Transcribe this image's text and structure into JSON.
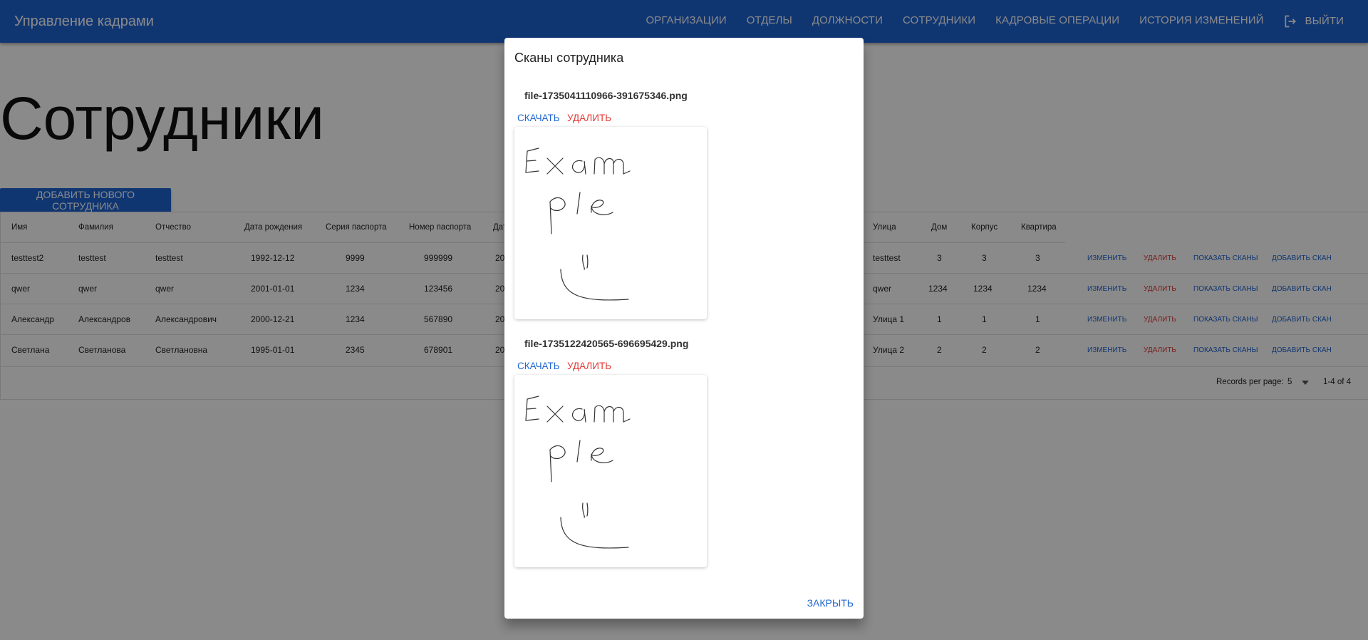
{
  "app": {
    "title": "Управление кадрами"
  },
  "nav": {
    "items": [
      "Организации",
      "Отделы",
      "Должности",
      "Сотрудники",
      "Кадровые операции",
      "История изменений"
    ],
    "logout": "Выйти",
    "active_index": 0
  },
  "page": {
    "title": "Сотрудники",
    "add_button": "Добавить нового сотрудника"
  },
  "table": {
    "headers_left": [
      "Имя",
      "Фамилия",
      "Отчество",
      "Дата рождения",
      "Серия паспорта",
      "Номер паспорта",
      "Дат"
    ],
    "headers_right": [
      "Улица",
      "Дом",
      "Корпус",
      "Квартира"
    ],
    "rows": [
      {
        "left": [
          "testtest2",
          "testtest",
          "testtest",
          "1992-12-12",
          "9999",
          "999999",
          "20"
        ],
        "right": [
          "testtest",
          "3",
          "3",
          "3"
        ]
      },
      {
        "left": [
          "qwer",
          "qwer",
          "qwer",
          "2001-01-01",
          "1234",
          "123456",
          "20"
        ],
        "right": [
          "qwer",
          "1234",
          "1234",
          "1234"
        ]
      },
      {
        "left": [
          "Александр",
          "Александров",
          "Александрович",
          "2000-12-21",
          "1234",
          "567890",
          "20"
        ],
        "right": [
          "Улица 1",
          "1",
          "1",
          "1"
        ]
      },
      {
        "left": [
          "Светлана",
          "Светланова",
          "Светлановна",
          "1995-01-01",
          "2345",
          "678901",
          "20"
        ],
        "right": [
          "Улица 2",
          "2",
          "2",
          "2"
        ]
      }
    ],
    "actions": [
      "Изменить",
      "Удалить",
      "Показать сканы",
      "Добавить скан"
    ],
    "footer": {
      "records_label": "Records per page:",
      "per_page": "5",
      "range": "1-4 of 4"
    }
  },
  "dialog": {
    "title": "Сканы сотрудника",
    "scans": [
      {
        "name": "file-1735041110966-391675346.png"
      },
      {
        "name": "file-1735122420565-696695429.png"
      }
    ],
    "download_label": "Скачать",
    "delete_label": "Удалить",
    "close_label": "Закрыть"
  },
  "colors": {
    "primary": "#1f65d2",
    "danger": "#e53935"
  }
}
